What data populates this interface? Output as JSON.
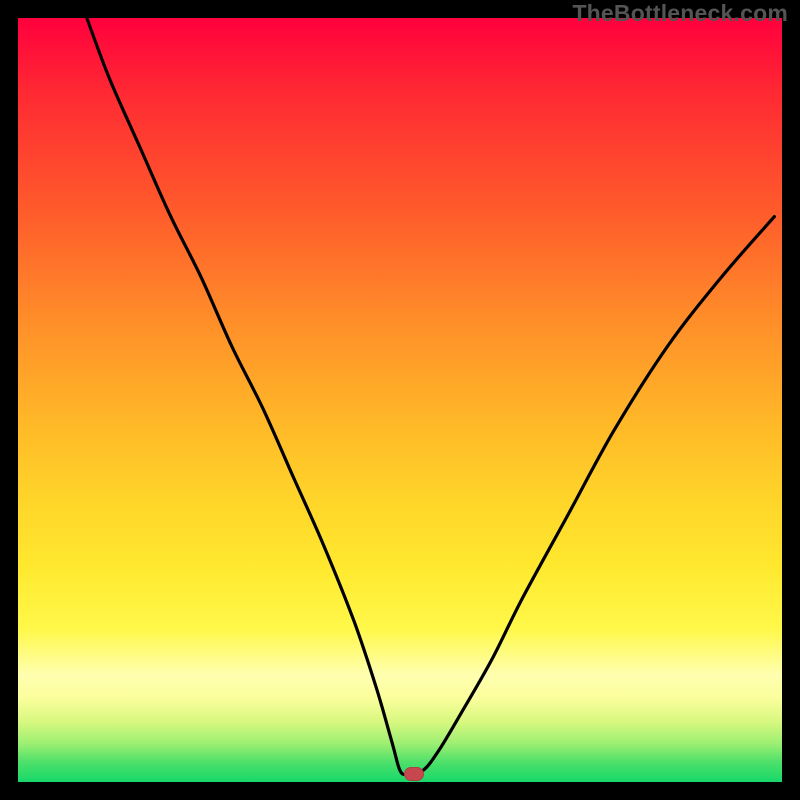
{
  "watermark": "TheBottleneck.com",
  "marker": {
    "x_pct": 51.8,
    "y_pct": 99.0
  },
  "colors": {
    "curve": "#000000",
    "marker": "#c6484e",
    "frame_bg": "#000000"
  },
  "chart_data": {
    "type": "line",
    "title": "",
    "xlabel": "",
    "ylabel": "",
    "xlim": [
      0,
      100
    ],
    "ylim": [
      0,
      100
    ],
    "grid": false,
    "note": "Axes are percent coordinates of the plot area; y=0 is bottom (green), y=100 is top (red). Curve values estimated from pixel positions.",
    "series": [
      {
        "name": "bottleneck-curve",
        "x": [
          9,
          12,
          16,
          20,
          24,
          28,
          32,
          36,
          40,
          44,
          47,
          49,
          50,
          51,
          53,
          55,
          58,
          62,
          66,
          72,
          78,
          85,
          92,
          99
        ],
        "y": [
          100,
          92,
          83,
          74,
          66,
          57,
          49,
          40,
          31,
          21,
          12,
          5,
          1.5,
          1,
          1.5,
          4,
          9,
          16,
          24,
          35,
          46,
          57,
          66,
          74
        ]
      }
    ],
    "marker_point": {
      "x": 51.8,
      "y": 1.0
    }
  }
}
